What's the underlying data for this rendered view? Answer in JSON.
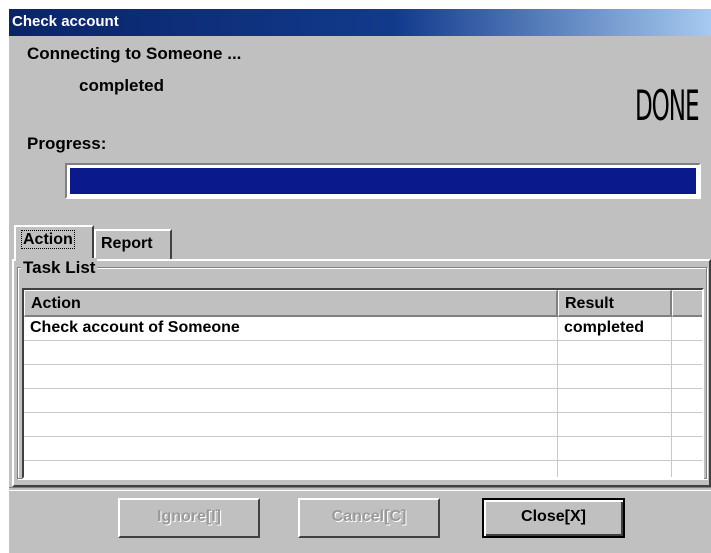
{
  "window": {
    "title": "Check account"
  },
  "status": {
    "connecting": "Connecting to Someone ...",
    "state": "completed",
    "done_label": "DONE",
    "progress_label": "Progress:",
    "progress_value": 1.0
  },
  "tabs": [
    {
      "label": "Action",
      "active": true
    },
    {
      "label": "Report",
      "active": false
    }
  ],
  "task_list": {
    "title": "Task List",
    "columns": [
      "Action",
      "Result"
    ],
    "rows": [
      {
        "action": "Check account of Someone",
        "result": "completed"
      }
    ]
  },
  "buttons": {
    "ignore": "Ignore[I]",
    "cancel": "Cancel[C]",
    "close": "Close[X]"
  },
  "colors": {
    "title_bar": "#0a246a",
    "progress": "#0a1a8c",
    "face": "#c0c0c0"
  }
}
